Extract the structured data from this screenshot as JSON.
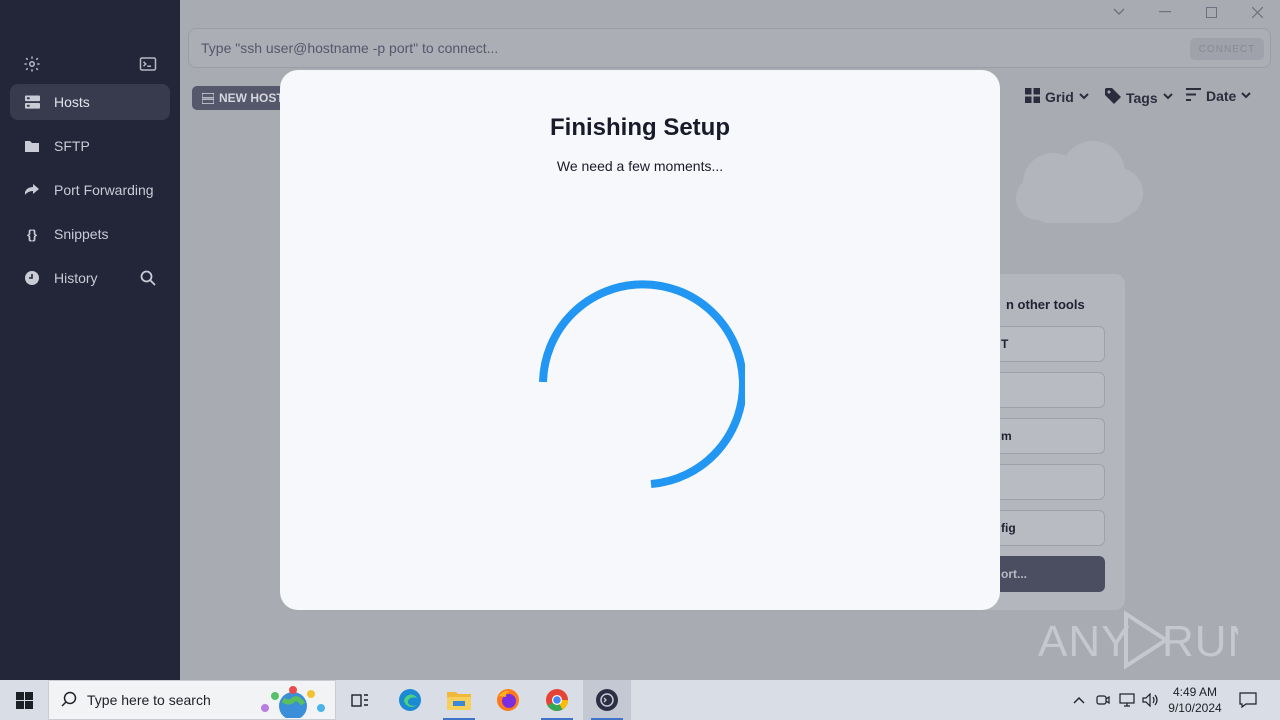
{
  "sidebar": {
    "items": [
      {
        "label": "Hosts",
        "icon": "hosts-icon"
      },
      {
        "label": "SFTP",
        "icon": "folder-icon"
      },
      {
        "label": "Port Forwarding",
        "icon": "forward-arrow-icon"
      },
      {
        "label": "Snippets",
        "icon": "braces-icon"
      },
      {
        "label": "History",
        "icon": "clock-icon"
      }
    ]
  },
  "toolbar": {
    "connect_placeholder": "Type \"ssh user@hostname -p port\" to connect...",
    "connect_label": "CONNECT",
    "new_host_label": "NEW HOST",
    "grid_label": "Grid",
    "tags_label": "Tags",
    "date_label": "Date"
  },
  "tools": {
    "title": "n other tools",
    "rows": [
      "T",
      "",
      "m",
      "",
      "fig",
      "ort..."
    ]
  },
  "modal": {
    "title": "Finishing Setup",
    "subtitle": "We need a few moments..."
  },
  "watermark": "ANY RUN",
  "taskbar": {
    "search_placeholder": "Type here to search",
    "time": "4:49 AM",
    "date": "9/10/2024"
  },
  "colors": {
    "sidebar_bg": "#232538",
    "spinner": "#2196f3",
    "modal_bg": "#f6f8fb"
  }
}
